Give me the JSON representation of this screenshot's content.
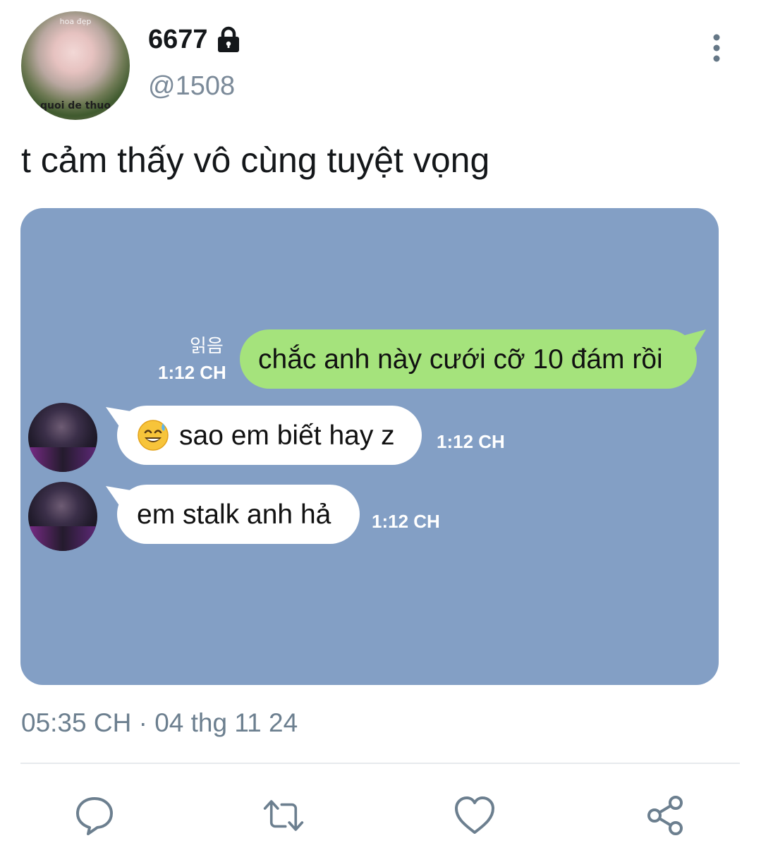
{
  "tweet": {
    "display_name": "6677",
    "handle": "@1508",
    "text": "t cảm thấy vô cùng tuyệt vọng",
    "timestamp": "05:35 CH · 04 thg 11 24",
    "avatar_caption_top": "hoa đẹp",
    "avatar_caption_bottom": "quoi de thuo"
  },
  "chat": {
    "read_label": "읽음",
    "messages": [
      {
        "direction": "outgoing",
        "text": "chắc anh này cưới cỡ 10 đám rồi",
        "time": "1:12 CH"
      },
      {
        "direction": "incoming",
        "emoji": "sweat-smile-emoji",
        "text": "sao em biết hay z",
        "time": "1:12 CH"
      },
      {
        "direction": "incoming",
        "text": "em stalk anh hả",
        "time": "1:12 CH"
      }
    ]
  },
  "actions": [
    "reply-icon",
    "retweet-icon",
    "like-icon",
    "share-icon"
  ],
  "colors": {
    "chat_background": "#839fc5",
    "outgoing_bubble": "#a5e37c",
    "incoming_bubble": "#ffffff",
    "secondary_text": "#7b8a99"
  }
}
